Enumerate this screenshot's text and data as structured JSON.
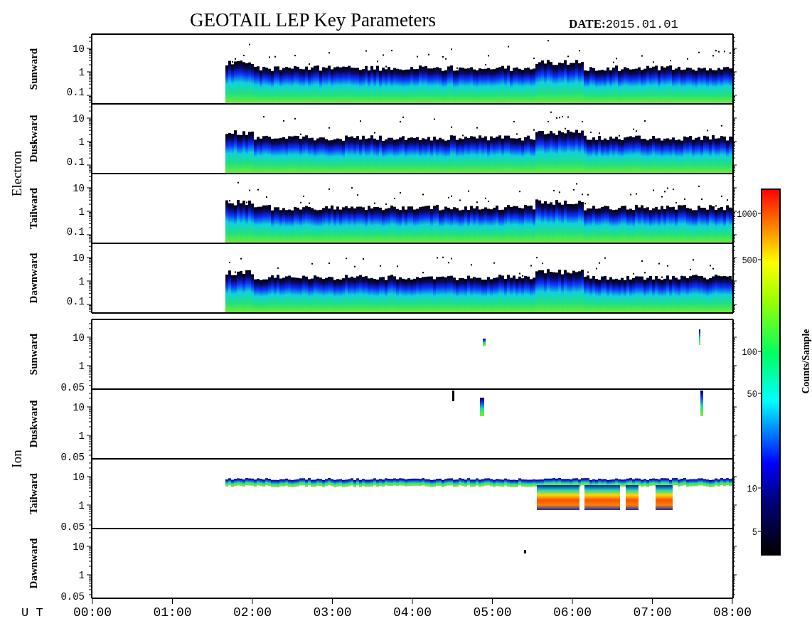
{
  "title": "GEOTAIL LEP Key Parameters",
  "date": {
    "label": "DATE:",
    "value": "2015.01.01"
  },
  "groups": [
    {
      "kind": "electron",
      "name": "Electron",
      "panels": [
        {
          "label": "Sunward",
          "yticks": [
            "10",
            "1",
            "0.1"
          ]
        },
        {
          "label": "Duskward",
          "yticks": [
            "10",
            "1",
            "0.1"
          ]
        },
        {
          "label": "Tailward",
          "yticks": [
            "10",
            "1",
            "0.1"
          ]
        },
        {
          "label": "Dawnward",
          "yticks": [
            "10",
            "1",
            "0.1"
          ]
        }
      ]
    },
    {
      "kind": "ion",
      "name": "Ion",
      "panels": [
        {
          "label": "Sunward",
          "yticks": [
            "10",
            "1",
            "0.05"
          ]
        },
        {
          "label": "Duskward",
          "yticks": [
            "10",
            "1",
            "0.05"
          ]
        },
        {
          "label": "Tailward",
          "yticks": [
            "10",
            "1",
            "0.05"
          ]
        },
        {
          "label": "Dawnward",
          "yticks": [
            "10",
            "1",
            "0.05"
          ]
        }
      ]
    }
  ],
  "colorbar": {
    "label": "Counts/Sample",
    "ticks": [
      "1000",
      "500",
      "100",
      "50",
      "10",
      "5"
    ]
  },
  "xaxis": {
    "label": "U T",
    "ticks": [
      "00:00",
      "01:00",
      "02:00",
      "03:00",
      "04:00",
      "05:00",
      "06:00",
      "07:00",
      "08:00"
    ]
  }
}
